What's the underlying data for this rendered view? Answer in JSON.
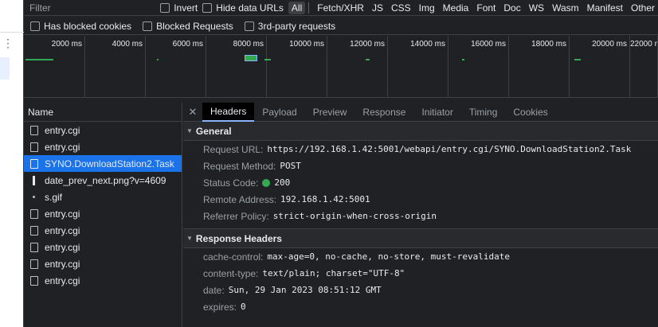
{
  "filter": {
    "placeholder": "Filter"
  },
  "row1_checkboxes": {
    "invert": "Invert",
    "hide_data_urls": "Hide data URLs"
  },
  "type_filters": [
    "All",
    "Fetch/XHR",
    "JS",
    "CSS",
    "Img",
    "Media",
    "Font",
    "Doc",
    "WS",
    "Wasm",
    "Manifest",
    "Other"
  ],
  "row2_checkboxes": {
    "blocked_cookies": "Has blocked cookies",
    "blocked_requests": "Blocked Requests",
    "third_party": "3rd-party requests"
  },
  "timeline_ticks": [
    "2000 ms",
    "4000 ms",
    "6000 ms",
    "8000 ms",
    "10000 ms",
    "12000 ms",
    "14000 ms",
    "16000 ms",
    "18000 ms",
    "20000 ms",
    "22000 ms"
  ],
  "colors": {
    "accent": "#1a73e8",
    "bar_green": "#34a853",
    "panel_bg": "#202124"
  },
  "list": {
    "header": "Name",
    "items": [
      {
        "name": "entry.cgi",
        "icon": "document-icon"
      },
      {
        "name": "entry.cgi",
        "icon": "document-icon"
      },
      {
        "name": "SYNO.DownloadStation2.Task",
        "icon": "document-icon",
        "selected": true
      },
      {
        "name": "date_prev_next.png?v=4609",
        "icon": "image-icon"
      },
      {
        "name": "s.gif",
        "icon": "dot-icon"
      },
      {
        "name": "entry.cgi",
        "icon": "document-icon"
      },
      {
        "name": "entry.cgi",
        "icon": "document-icon"
      },
      {
        "name": "entry.cgi",
        "icon": "document-icon"
      },
      {
        "name": "entry.cgi",
        "icon": "document-icon"
      },
      {
        "name": "entry.cgi",
        "icon": "document-icon"
      }
    ]
  },
  "tabs": [
    "Headers",
    "Payload",
    "Preview",
    "Response",
    "Initiator",
    "Timing",
    "Cookies"
  ],
  "general": {
    "title": "General",
    "request_url_label": "Request URL:",
    "request_url": "https://192.168.1.42:5001/webapi/entry.cgi/SYNO.DownloadStation2.Task",
    "request_method_label": "Request Method:",
    "request_method": "POST",
    "status_code_label": "Status Code:",
    "status_code": "200",
    "remote_address_label": "Remote Address:",
    "remote_address": "192.168.1.42:5001",
    "referrer_policy_label": "Referrer Policy:",
    "referrer_policy": "strict-origin-when-cross-origin"
  },
  "response_headers": {
    "title": "Response Headers",
    "cache_control_label": "cache-control:",
    "cache_control": "max-age=0, no-cache, no-store, must-revalidate",
    "content_type_label": "content-type:",
    "content_type": "text/plain; charset=\"UTF-8\"",
    "date_label": "date:",
    "date": "Sun, 29 Jan 2023 08:51:12 GMT",
    "expires_label": "expires:",
    "expires": "0"
  }
}
